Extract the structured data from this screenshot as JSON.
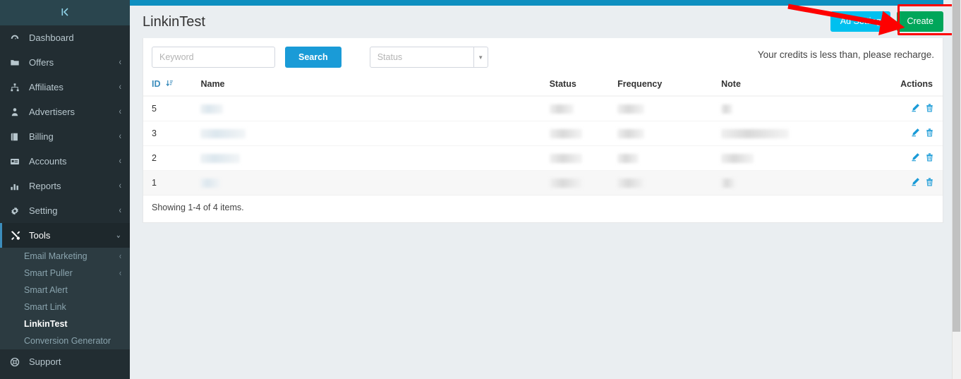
{
  "sidebar": {
    "collapse_icon": "collapse-sidebar-icon",
    "items": [
      {
        "label": "Dashboard",
        "icon": "dashboard-gauge-icon",
        "caret": "",
        "active": false
      },
      {
        "label": "Offers",
        "icon": "folder-icon",
        "caret": "‹",
        "active": false
      },
      {
        "label": "Affiliates",
        "icon": "sitemap-icon",
        "caret": "‹",
        "active": false
      },
      {
        "label": "Advertisers",
        "icon": "user-tie-icon",
        "caret": "‹",
        "active": false
      },
      {
        "label": "Billing",
        "icon": "book-icon",
        "caret": "‹",
        "active": false
      },
      {
        "label": "Accounts",
        "icon": "id-card-icon",
        "caret": "‹",
        "active": false
      },
      {
        "label": "Reports",
        "icon": "bar-chart-icon",
        "caret": "‹",
        "active": false
      },
      {
        "label": "Setting",
        "icon": "gear-icon",
        "caret": "‹",
        "active": false
      },
      {
        "label": "Tools",
        "icon": "tools-wrench-icon",
        "caret": "⌄",
        "active": true
      }
    ],
    "submenu": [
      {
        "label": "Email Marketing",
        "caret": "‹",
        "current": false
      },
      {
        "label": "Smart Puller",
        "caret": "‹",
        "current": false
      },
      {
        "label": "Smart Alert",
        "caret": "",
        "current": false
      },
      {
        "label": "Smart Link",
        "caret": "",
        "current": false
      },
      {
        "label": "LinkinTest",
        "caret": "",
        "current": true
      },
      {
        "label": "Conversion Generator",
        "caret": "",
        "current": false
      }
    ],
    "support": {
      "label": "Support",
      "icon": "support-lifering-icon"
    }
  },
  "header": {
    "title": "LinkinTest",
    "buttons": [
      {
        "label": "Ad Setting",
        "style": "info",
        "name": "ad-setting-button"
      },
      {
        "label": "Create",
        "style": "success",
        "name": "create-button"
      }
    ]
  },
  "filters": {
    "keyword_placeholder": "Keyword",
    "keyword_value": "",
    "search_label": "Search",
    "status_selected": "Status",
    "status_options": [
      "Status"
    ]
  },
  "notice": {
    "credits_message": "Your credits is less than, please recharge."
  },
  "table": {
    "columns": [
      "ID",
      "Name",
      "Status",
      "Frequency",
      "Note",
      "Actions"
    ],
    "sort_column": "ID",
    "sort_icon": "sort-descending-icon",
    "rows": [
      {
        "id": "5",
        "name": "",
        "name_w": 32,
        "status": "",
        "status_w": 34,
        "frequency": "",
        "frequency_w": 38,
        "note": "",
        "note_w": 16,
        "striped": false
      },
      {
        "id": "3",
        "name": "",
        "name_w": 64,
        "status": "",
        "status_w": 46,
        "frequency": "",
        "frequency_w": 38,
        "note": "",
        "note_w": 96,
        "striped": false
      },
      {
        "id": "2",
        "name": "",
        "name_w": 56,
        "status": "",
        "status_w": 46,
        "frequency": "",
        "frequency_w": 30,
        "note": "",
        "note_w": 46,
        "striped": false
      },
      {
        "id": "1",
        "name": "",
        "name_w": 28,
        "status": "",
        "status_w": 46,
        "frequency": "",
        "frequency_w": 38,
        "note": "",
        "note_w": 20,
        "striped": true
      }
    ],
    "row_actions": [
      {
        "name": "edit-row-icon",
        "icon": "pencil-icon"
      },
      {
        "name": "delete-row-icon",
        "icon": "trash-icon"
      }
    ],
    "footer": "Showing 1-4 of 4 items."
  },
  "annotation": {
    "arrow_color": "#fe0000",
    "highlight_color": "#fe0000",
    "target": "create-button"
  },
  "colors": {
    "sidebar_bg": "#222d32",
    "topbar": "#0e8fc0",
    "accent_blue": "#1a9bd7",
    "info": "#00c0ef",
    "success": "#00a65a",
    "page_bg": "#eaeef1"
  }
}
